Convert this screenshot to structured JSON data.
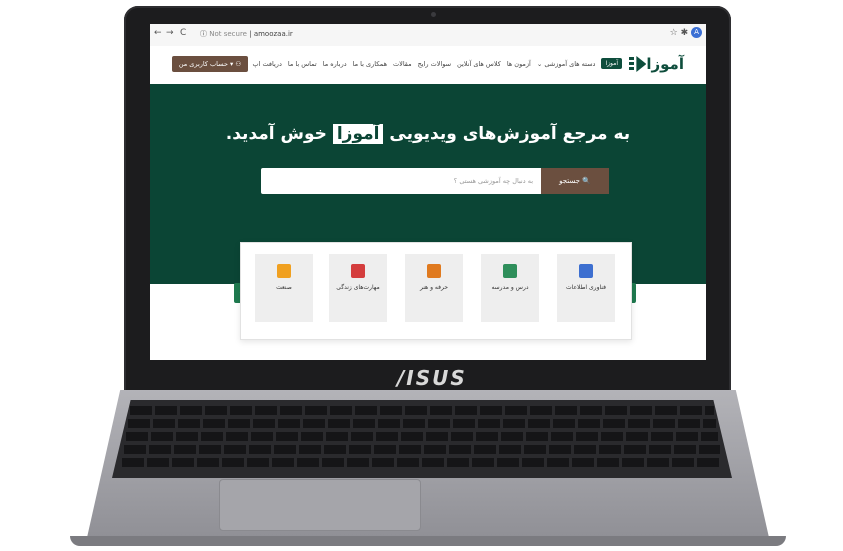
{
  "device": {
    "brand": "/ISUS"
  },
  "browser": {
    "back_glyph": "←",
    "forward_glyph": "→",
    "reload_glyph": "C",
    "security": "Not secure",
    "url": "amoozaa.ir",
    "star_glyph": "☆",
    "ext_glyph": "✱",
    "avatar_letter": "A"
  },
  "header": {
    "logo_text": "آموزا",
    "menu": [
      {
        "label": "آموزا",
        "tag": true
      },
      {
        "label": "دسته های آموزشی ⌄"
      },
      {
        "label": "آزمون ها"
      },
      {
        "label": "کلاس های آنلاین"
      },
      {
        "label": "سوالات رایج"
      },
      {
        "label": "مقالات"
      },
      {
        "label": "همکاری با ما"
      },
      {
        "label": "درباره ما"
      },
      {
        "label": "تماس با ما"
      },
      {
        "label": "دریافت اپ"
      }
    ],
    "login_label": "حساب کاربری من ▾ ⚇",
    "colors": {
      "primary": "#0b4535",
      "accent": "#6b4f3f"
    }
  },
  "hero": {
    "title_before": "به مرجع آموزش‌های ویدیویی",
    "title_highlight": "آموزا",
    "title_after": "خوش آمدید.",
    "search_placeholder": "به دنبال چه آموزشی هستی ؟",
    "search_button": "جستجو 🔍"
  },
  "categories": [
    {
      "label": "فناوری اطلاعات",
      "icon": "it-icon",
      "color": "#3d6fd0"
    },
    {
      "label": "درس و مدرسه",
      "icon": "chalkboard-icon",
      "color": "#2f8f5b"
    },
    {
      "label": "حرفه و هنر",
      "icon": "art-icon",
      "color": "#e07a1f"
    },
    {
      "label": "مهارت‌های زندگی",
      "icon": "house-icon",
      "color": "#d43d3d"
    },
    {
      "label": "صنعت",
      "icon": "gear-icon",
      "color": "#f0a020"
    }
  ],
  "carousel": {
    "prev_glyph": "‹",
    "next_glyph": "›"
  }
}
